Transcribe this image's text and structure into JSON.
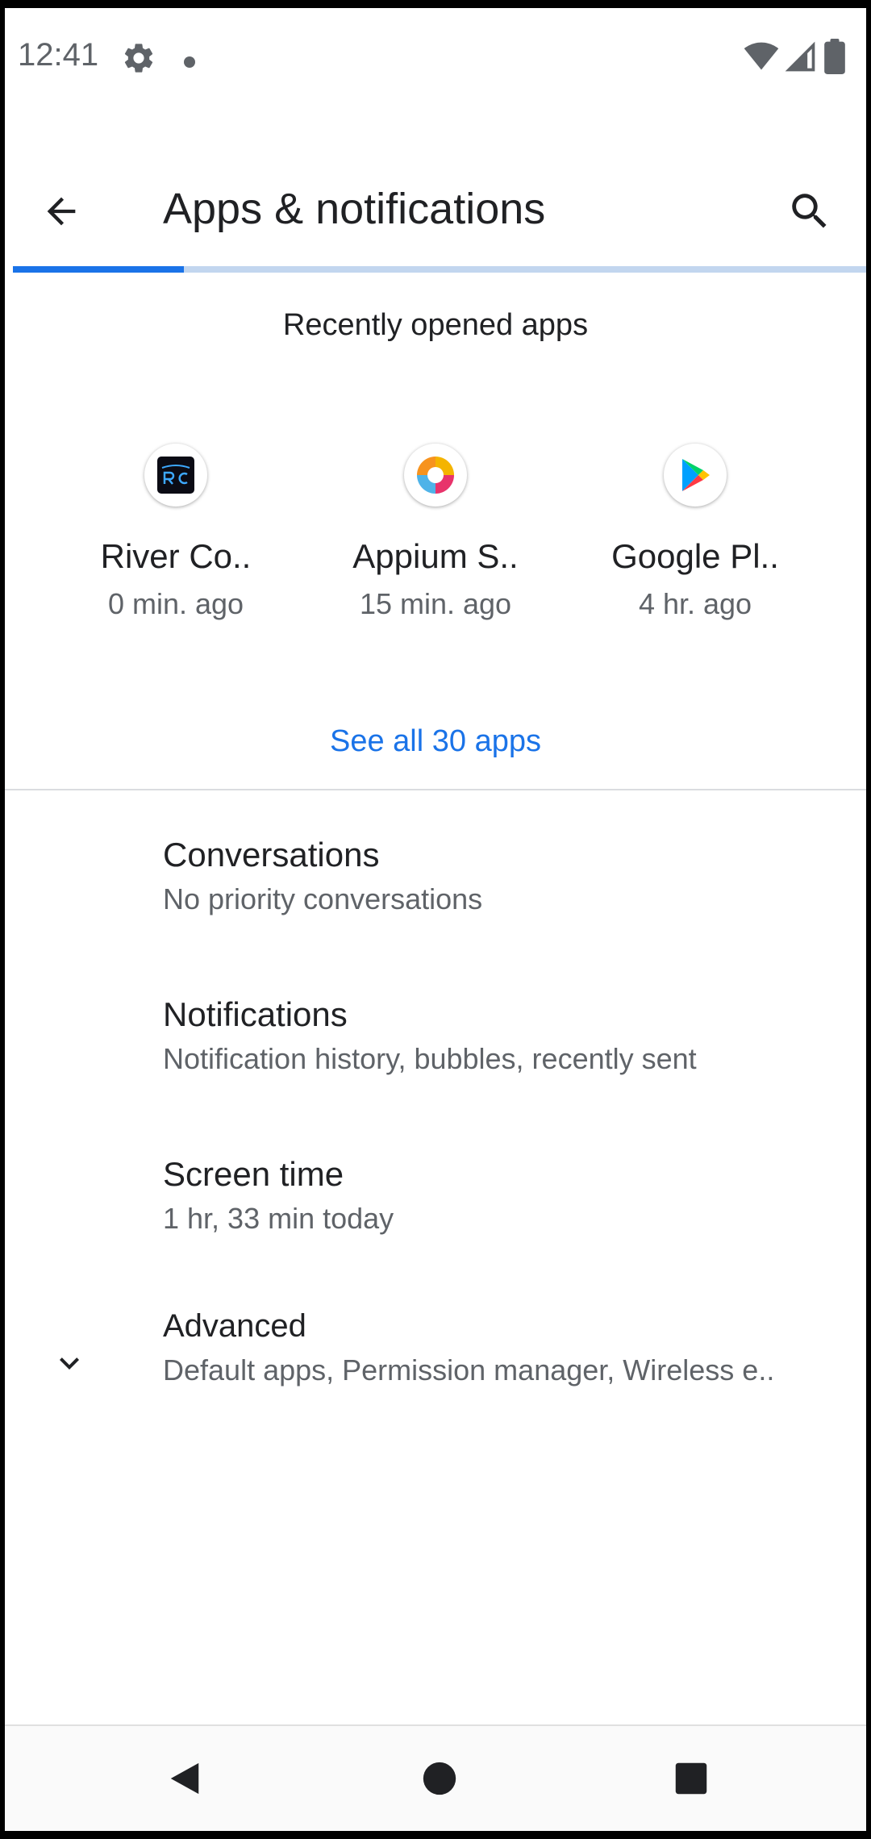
{
  "status_bar": {
    "time": "12:41",
    "icons": [
      "settings-gear-icon",
      "notification-dot-icon",
      "wifi-icon",
      "cellular-signal-icon",
      "battery-icon"
    ]
  },
  "app_bar": {
    "title": "Apps & notifications",
    "back_icon": "arrow-back-icon",
    "search_icon": "search-icon",
    "loading_progress": 0.2
  },
  "recent_apps": {
    "header": "Recently opened apps",
    "apps": [
      {
        "name": "River Co..",
        "time": "0 min. ago",
        "icon": "river-connect-icon"
      },
      {
        "name": "Appium S..",
        "time": "15 min. ago",
        "icon": "appium-settings-icon"
      },
      {
        "name": "Google Pl..",
        "time": "4 hr. ago",
        "icon": "google-play-icon"
      }
    ],
    "see_all": "See all 30 apps"
  },
  "settings": [
    {
      "title": "Conversations",
      "subtitle": "No priority conversations"
    },
    {
      "title": "Notifications",
      "subtitle": "Notification history, bubbles, recently sent"
    },
    {
      "title": "Screen time",
      "subtitle": "1 hr, 33 min today"
    },
    {
      "title": "Advanced",
      "subtitle": "Default apps, Permission manager, Wireless e..",
      "icon": "chevron-down-icon"
    }
  ],
  "nav_bar": {
    "buttons": [
      "nav-back-icon",
      "nav-home-icon",
      "nav-recents-icon"
    ]
  },
  "colors": {
    "accent": "#1a73e8",
    "progress_track": "#c2d6ef",
    "text_primary": "#202124",
    "text_secondary": "#5f6368"
  }
}
